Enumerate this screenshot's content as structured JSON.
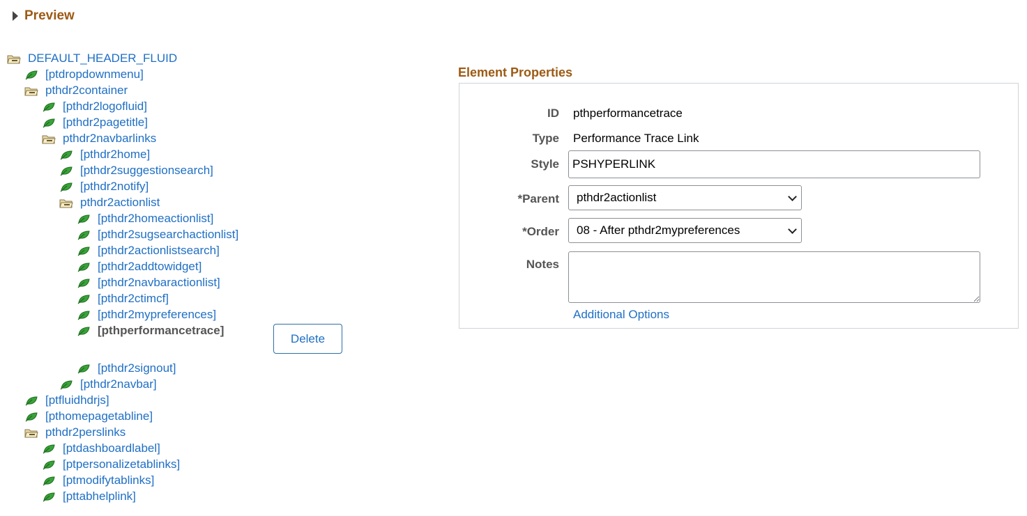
{
  "preview": {
    "label": "Preview"
  },
  "tree": [
    {
      "label": "DEFAULT_HEADER_FLUID",
      "type": "folder",
      "depth": 0
    },
    {
      "label": "[ptdropdownmenu]",
      "type": "leaf",
      "depth": 1
    },
    {
      "label": "pthdr2container",
      "type": "folder",
      "depth": 1
    },
    {
      "label": "[pthdr2logofluid]",
      "type": "leaf",
      "depth": 2
    },
    {
      "label": "[pthdr2pagetitle]",
      "type": "leaf",
      "depth": 2
    },
    {
      "label": "pthdr2navbarlinks",
      "type": "folder",
      "depth": 2
    },
    {
      "label": "[pthdr2home]",
      "type": "leaf",
      "depth": 3
    },
    {
      "label": "[pthdr2suggestionsearch]",
      "type": "leaf",
      "depth": 3
    },
    {
      "label": "[pthdr2notify]",
      "type": "leaf",
      "depth": 3
    },
    {
      "label": "pthdr2actionlist",
      "type": "folder",
      "depth": 3
    },
    {
      "label": "[pthdr2homeactionlist]",
      "type": "leaf",
      "depth": 4
    },
    {
      "label": "[pthdr2sugsearchactionlist]",
      "type": "leaf",
      "depth": 4
    },
    {
      "label": "[pthdr2actionlistsearch]",
      "type": "leaf",
      "depth": 4
    },
    {
      "label": "[pthdr2addtowidget]",
      "type": "leaf",
      "depth": 4
    },
    {
      "label": "[pthdr2navbaractionlist]",
      "type": "leaf",
      "depth": 4
    },
    {
      "label": "[pthdr2ctimcf]",
      "type": "leaf",
      "depth": 4
    },
    {
      "label": "[pthdr2mypreferences]",
      "type": "leaf",
      "depth": 4
    },
    {
      "label": "[pthperformancetrace]",
      "type": "leaf",
      "depth": 4,
      "selected": true
    },
    {
      "label": "[pthdr2signout]",
      "type": "leaf",
      "depth": 4
    },
    {
      "label": "[pthdr2navbar]",
      "type": "leaf",
      "depth": 3
    },
    {
      "label": "[ptfluidhdrjs]",
      "type": "leaf",
      "depth": 1
    },
    {
      "label": "[pthomepagetabline]",
      "type": "leaf",
      "depth": 1
    },
    {
      "label": "pthdr2perslinks",
      "type": "folder",
      "depth": 1
    },
    {
      "label": "[ptdashboardlabel]",
      "type": "leaf",
      "depth": 2
    },
    {
      "label": "[ptpersonalizetablinks]",
      "type": "leaf",
      "depth": 2
    },
    {
      "label": "[ptmodifytablinks]",
      "type": "leaf",
      "depth": 2
    },
    {
      "label": "[pttabhelplink]",
      "type": "leaf",
      "depth": 2
    }
  ],
  "delete_button": "Delete",
  "element_properties": {
    "title": "Element Properties",
    "id_label": "ID",
    "id_value": "pthperformancetrace",
    "type_label": "Type",
    "type_value": "Performance Trace Link",
    "style_label": "Style",
    "style_value": "PSHYPERLINK",
    "parent_label": "*Parent",
    "parent_value": "pthdr2actionlist",
    "order_label": "*Order",
    "order_value": "08 - After pthdr2mypreferences",
    "notes_label": "Notes",
    "notes_value": "",
    "additional_options": "Additional Options"
  },
  "colors": {
    "link": "#1f6fc5",
    "heading": "#9c5a14",
    "leaf": "#3aa23a",
    "folder": "#c8a35a"
  }
}
